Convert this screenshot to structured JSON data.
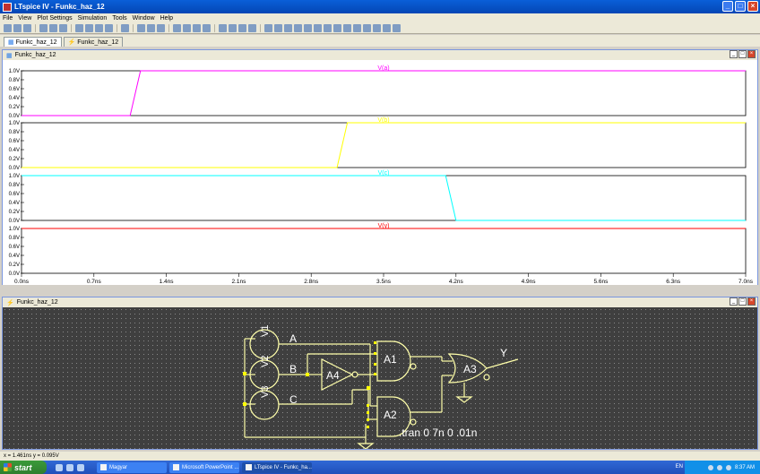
{
  "window": {
    "title": "LTspice IV - Funkc_haz_12"
  },
  "menu": [
    "File",
    "View",
    "Plot Settings",
    "Simulation",
    "Tools",
    "Window",
    "Help"
  ],
  "tabs": [
    {
      "label": "Funkc_haz_12",
      "active": true
    },
    {
      "label": "Funkc_haz_12",
      "active": false
    }
  ],
  "plot_panel": {
    "title": "Funkc_haz_12"
  },
  "schematic_panel": {
    "title": "Funkc_haz_12"
  },
  "chart_data": {
    "type": "line",
    "x_unit": "ns",
    "xlim": [
      0,
      7
    ],
    "x_ticks": [
      "0.0ns",
      "0.7ns",
      "1.4ns",
      "2.1ns",
      "2.8ns",
      "3.5ns",
      "4.2ns",
      "4.9ns",
      "5.6ns",
      "6.3ns",
      "7.0ns"
    ],
    "y_ticks": [
      "1.0V",
      "0.8V",
      "0.6V",
      "0.4V",
      "0.2V",
      "0.0V"
    ],
    "ylim": [
      0,
      1
    ],
    "grid": false,
    "panes": [
      {
        "name": "V(a)",
        "color": "#ff00ff",
        "x": [
          0,
          1.05,
          1.15,
          7
        ],
        "y": [
          0,
          0,
          1,
          1
        ]
      },
      {
        "name": "V(b)",
        "color": "#ffff00",
        "x": [
          0,
          3.05,
          3.15,
          7
        ],
        "y": [
          0,
          0,
          1,
          1
        ]
      },
      {
        "name": "V(c)",
        "color": "#00ffff",
        "x": [
          0,
          4.1,
          4.2,
          7
        ],
        "y": [
          1,
          1,
          0,
          0
        ]
      },
      {
        "name": "V(y)",
        "color": "#ff0000",
        "x": [
          0,
          7
        ],
        "y": [
          1,
          1
        ]
      }
    ]
  },
  "schematic": {
    "sources": [
      "V1",
      "V2",
      "V3"
    ],
    "nets": [
      "A",
      "B",
      "C",
      "Y"
    ],
    "gates": [
      "A1",
      "A2",
      "A3",
      "A4"
    ],
    "directive": ".tran 0 7n 0 .01n"
  },
  "status": {
    "text": "x = 1.461ns   y = 0.095V"
  },
  "taskbar": {
    "start": "start",
    "tasks": [
      "Magyar",
      "Microsoft PowerPoint ...",
      "LTspice IV - Funkc_ha..."
    ],
    "lang": "EN",
    "clock": "8:37 AM"
  }
}
